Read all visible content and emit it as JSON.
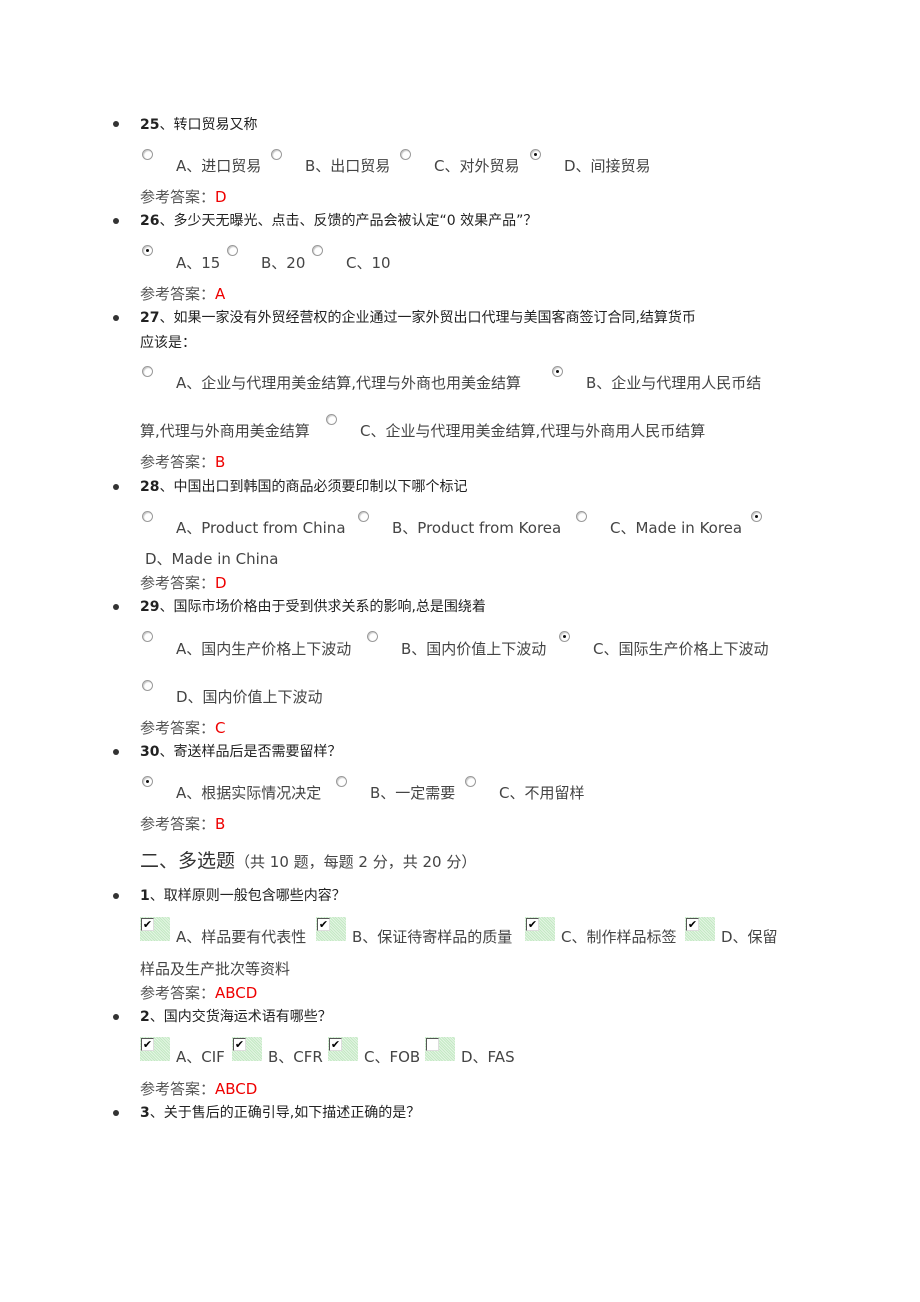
{
  "answer_label": "参考答案：",
  "single_choice": [
    {
      "number": "25",
      "text": "、转口贸易又称",
      "options": [
        {
          "label": "A、进口贸易",
          "selected": false
        },
        {
          "label": "B、出口贸易",
          "selected": false
        },
        {
          "label": "C、对外贸易",
          "selected": false
        },
        {
          "label": "D、间接贸易",
          "selected": true
        }
      ],
      "answer": "D"
    },
    {
      "number": "26",
      "text": "、多少天无曝光、点击、反馈的产品会被认定“0 效果产品”？",
      "options": [
        {
          "label": "A、15",
          "selected": true
        },
        {
          "label": "B、20",
          "selected": false
        },
        {
          "label": "C、10",
          "selected": false
        }
      ],
      "answer": "A"
    },
    {
      "number": "27",
      "text_line1": "、如果一家没有外贸经营权的企业通过一家外贸出口代理与美国客商签订合同,结算货币",
      "text_line2": "应该是：",
      "options": [
        {
          "label": "A、企业与代理用美金结算,代理与外商也用美金结算",
          "selected": false
        },
        {
          "label_line1": "B、企业与代理用人民币结",
          "label_line2": "算,代理与外商用美金结算",
          "selected": true
        },
        {
          "label": "C、企业与代理用美金结算,代理与外商用人民币结算",
          "selected": false
        }
      ],
      "answer": "B"
    },
    {
      "number": "28",
      "text": "、中国出口到韩国的商品必须要印制以下哪个标记",
      "options": [
        {
          "label": "A、Product from China",
          "selected": false
        },
        {
          "label": "B、Product from Korea",
          "selected": false
        },
        {
          "label": "C、Made in Korea",
          "selected": false
        },
        {
          "label": "D、Made in China",
          "selected": true
        }
      ],
      "answer": "D"
    },
    {
      "number": "29",
      "text": "、国际市场价格由于受到供求关系的影响,总是围绕着",
      "options": [
        {
          "label": "A、国内生产价格上下波动",
          "selected": false
        },
        {
          "label": "B、国内价值上下波动",
          "selected": false
        },
        {
          "label": "C、国际生产价格上下波动",
          "selected": true
        },
        {
          "label": "D、国内价值上下波动",
          "selected": false
        }
      ],
      "answer": "C"
    },
    {
      "number": "30",
      "text": "、寄送样品后是否需要留样？",
      "options": [
        {
          "label": "A、根据实际情况决定",
          "selected": true
        },
        {
          "label": "B、一定需要",
          "selected": false
        },
        {
          "label": "C、不用留样",
          "selected": false
        }
      ],
      "answer": "B"
    }
  ],
  "section2": {
    "title": "二、多选题",
    "subtitle": "（共 10 题，每题 2 分，共 20 分）"
  },
  "multi_choice": [
    {
      "number": "1",
      "text": "、取样原则一般包含哪些内容？",
      "options": [
        {
          "label": "A、样品要有代表性",
          "checked": true
        },
        {
          "label": "B、保证待寄样品的质量",
          "checked": true
        },
        {
          "label": "C、制作样品标签",
          "checked": true
        },
        {
          "label_line1": "D、保留",
          "label_line2": "样品及生产批次等资料",
          "checked": true
        }
      ],
      "answer": "ABCD"
    },
    {
      "number": "2",
      "text": "、国内交货海运术语有哪些？",
      "options": [
        {
          "label": "A、CIF",
          "checked": true
        },
        {
          "label": "B、CFR",
          "checked": true
        },
        {
          "label": "C、FOB",
          "checked": true
        },
        {
          "label": "D、FAS",
          "checked": false
        }
      ],
      "answer": "ABCD"
    },
    {
      "number": "3",
      "text": "、关于售后的正确引导,如下描述正确的是？"
    }
  ],
  "check_glyph": "✔"
}
